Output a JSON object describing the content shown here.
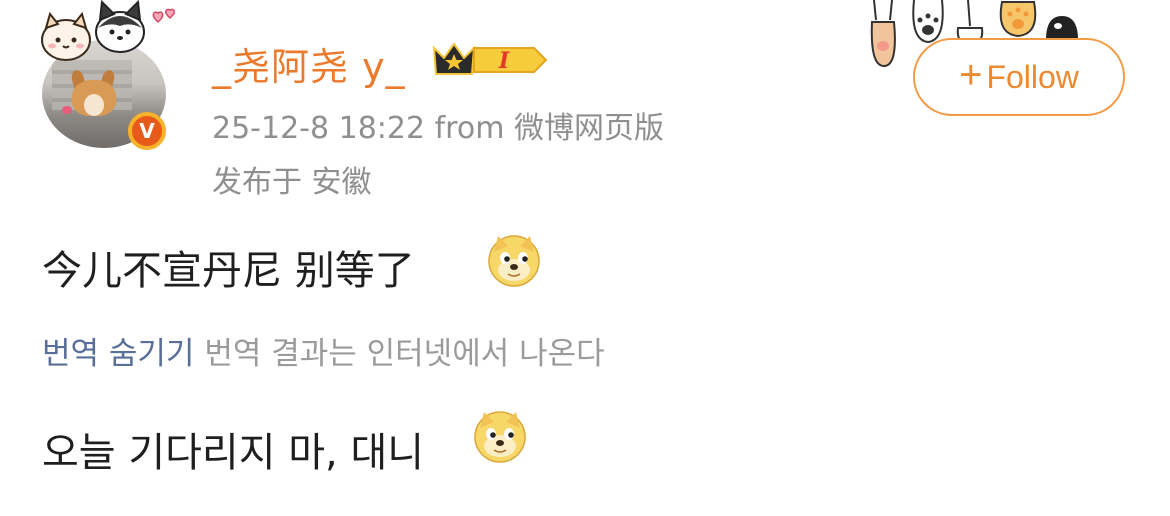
{
  "post": {
    "username": "_尧阿尧 y_",
    "member_badge_letter": "I",
    "verified_badge_letter": "V",
    "meta": "25-12-8 18:22  from 微博网页版",
    "location": "发布于 安徽",
    "text": "今儿不宣丹尼  别等了",
    "emoji_name": "doge-emoji"
  },
  "follow": {
    "plus": "+",
    "label": "Follow"
  },
  "translation": {
    "link_label": "번역 숨기기",
    "note": "번역 결과는 인터넷에서 나온다",
    "text": "오늘 기다리지 마, 대니"
  },
  "colors": {
    "username": "#eb7a2d",
    "follow_border": "#f29b44",
    "translation_link": "#5a6f98",
    "meta_gray": "#8f8f8f"
  }
}
